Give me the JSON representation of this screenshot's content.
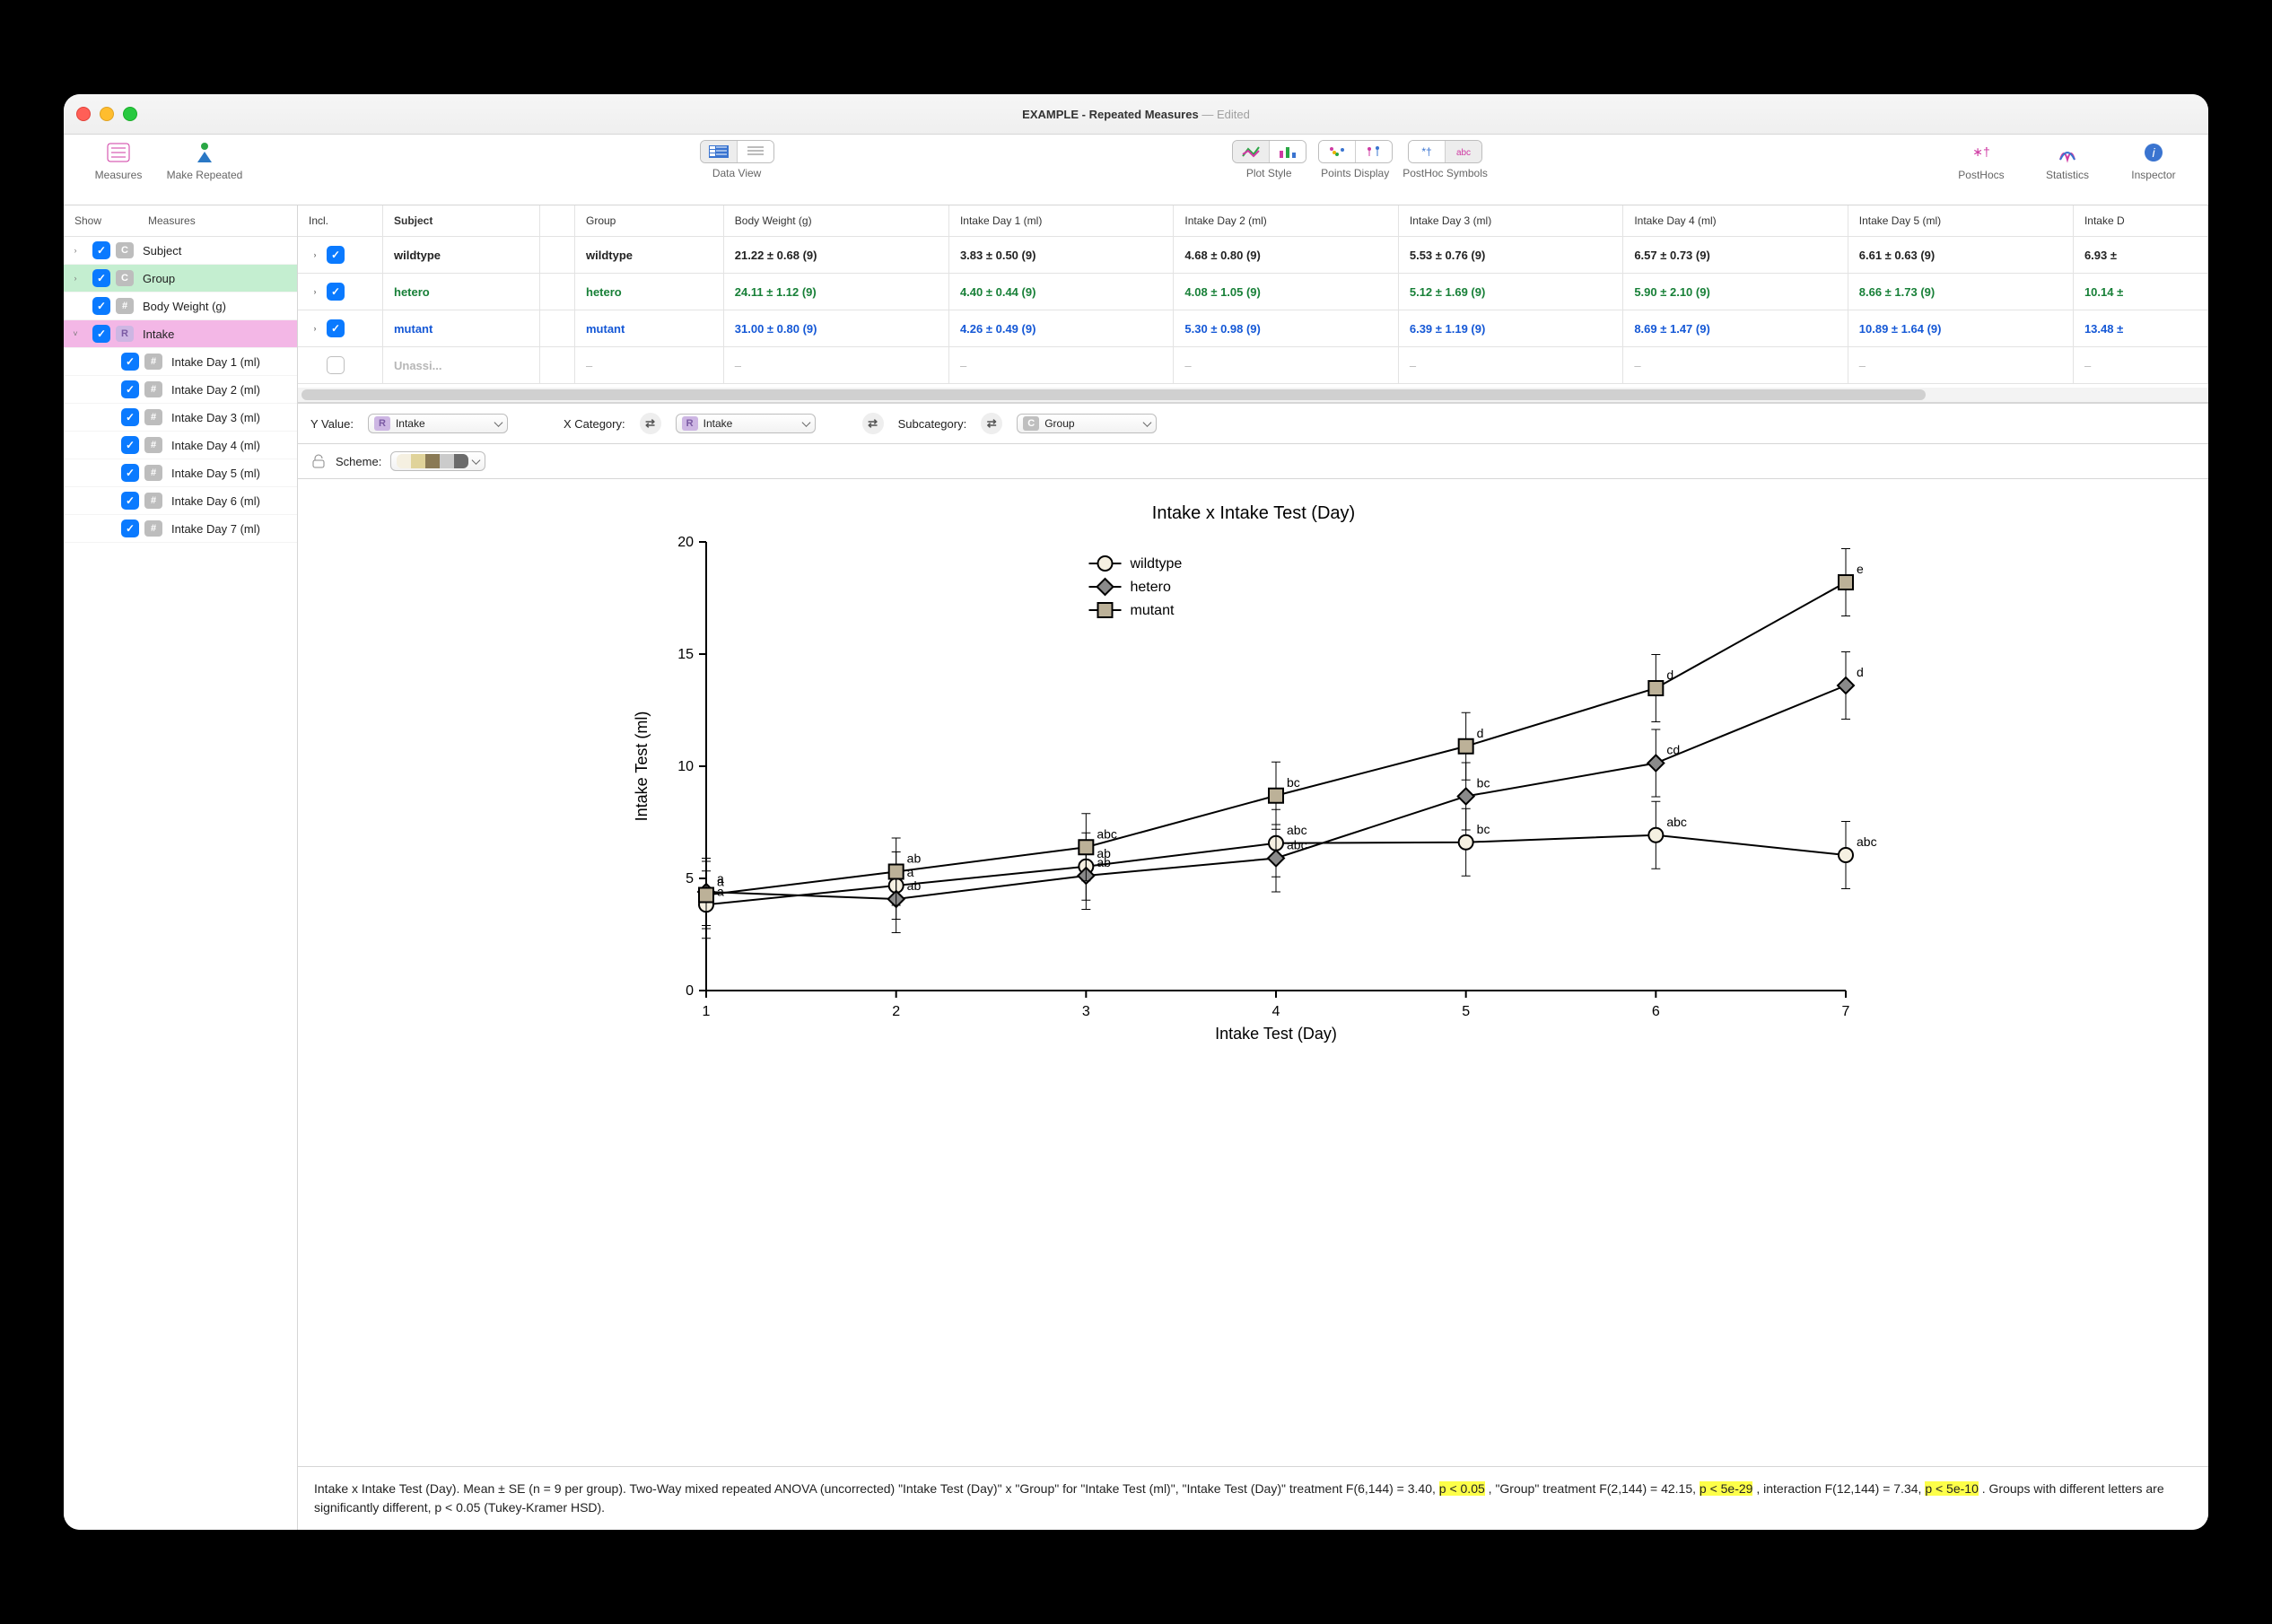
{
  "window_title": "EXAMPLE - Repeated Measures",
  "window_edited": "Edited",
  "toolbar": {
    "measures": "Measures",
    "make_repeated": "Make Repeated",
    "data_view": "Data View",
    "plot_style": "Plot Style",
    "points_display": "Points Display",
    "posthoc_symbols": "PostHoc Symbols",
    "posthocs": "PostHocs",
    "statistics": "Statistics",
    "inspector": "Inspector"
  },
  "sidebar": {
    "show": "Show",
    "measures": "Measures",
    "items": [
      {
        "label": "Subject",
        "icon": "C",
        "expandable": true,
        "checked": true,
        "hl": ""
      },
      {
        "label": "Group",
        "icon": "C",
        "expandable": true,
        "checked": true,
        "hl": "green"
      },
      {
        "label": "Body Weight (g)",
        "icon": "#",
        "expandable": false,
        "checked": true,
        "hl": ""
      },
      {
        "label": "Intake",
        "icon": "R",
        "expandable": true,
        "checked": true,
        "hl": "pink",
        "open": true
      },
      {
        "label": "Intake Day 1 (ml)",
        "icon": "#",
        "child": true,
        "checked": true
      },
      {
        "label": "Intake Day 2 (ml)",
        "icon": "#",
        "child": true,
        "checked": true
      },
      {
        "label": "Intake Day 3 (ml)",
        "icon": "#",
        "child": true,
        "checked": true
      },
      {
        "label": "Intake Day 4 (ml)",
        "icon": "#",
        "child": true,
        "checked": true
      },
      {
        "label": "Intake Day 5 (ml)",
        "icon": "#",
        "child": true,
        "checked": true
      },
      {
        "label": "Intake Day 6 (ml)",
        "icon": "#",
        "child": true,
        "checked": true
      },
      {
        "label": "Intake Day 7 (ml)",
        "icon": "#",
        "child": true,
        "checked": true
      }
    ]
  },
  "table": {
    "headers": [
      "Incl.",
      "Subject",
      "",
      "Group",
      "Body Weight (g)",
      "Intake Day 1 (ml)",
      "Intake Day 2 (ml)",
      "Intake Day 3 (ml)",
      "Intake Day 4 (ml)",
      "Intake Day 5 (ml)",
      "Intake D"
    ],
    "rows": [
      {
        "cls": "wildtype",
        "incl": true,
        "subject": "wildtype",
        "group": "wildtype",
        "cells": [
          "21.22 ± 0.68 (9)",
          "3.83 ± 0.50 (9)",
          "4.68 ± 0.80 (9)",
          "5.53 ± 0.76 (9)",
          "6.57 ± 0.73 (9)",
          "6.61 ± 0.63 (9)",
          "6.93 ±"
        ]
      },
      {
        "cls": "hetero",
        "incl": true,
        "subject": "hetero",
        "group": "hetero",
        "cells": [
          "24.11 ± 1.12 (9)",
          "4.40 ± 0.44 (9)",
          "4.08 ± 1.05 (9)",
          "5.12 ± 1.69 (9)",
          "5.90 ± 2.10 (9)",
          "8.66 ± 1.73 (9)",
          "10.14 ±"
        ]
      },
      {
        "cls": "mutant",
        "incl": true,
        "subject": "mutant",
        "group": "mutant",
        "cells": [
          "31.00 ± 0.80 (9)",
          "4.26 ± 0.49 (9)",
          "5.30 ± 0.98 (9)",
          "6.39 ± 1.19 (9)",
          "8.69 ± 1.47 (9)",
          "10.89 ± 1.64 (9)",
          "13.48 ±"
        ]
      },
      {
        "cls": "unassigned",
        "incl": false,
        "subject": "Unassi...",
        "group": "–",
        "cells": [
          "–",
          "–",
          "–",
          "–",
          "–",
          "–",
          "–"
        ]
      }
    ]
  },
  "controls": {
    "yvalue_label": "Y Value:",
    "yvalue_value": "Intake",
    "xcat_label": "X Category:",
    "xcat_value": "Intake",
    "subcat_label": "Subcategory:",
    "subcat_value": "Group",
    "scheme_label": "Scheme:"
  },
  "chart": {
    "title": "Intake x Intake Test (Day)",
    "ylabel": "Intake Test (ml)",
    "xlabel": "Intake Test (Day)",
    "legend": {
      "wildtype": "wildtype",
      "hetero": "hetero",
      "mutant": "mutant"
    },
    "ticks_y": [
      "0",
      "5",
      "10",
      "15",
      "20"
    ],
    "ticks_x": [
      "1",
      "2",
      "3",
      "4",
      "5",
      "6",
      "7"
    ],
    "annos": {
      "wildtype": [
        "a",
        "a",
        "ab",
        "abc",
        "bc",
        "abc",
        "abc"
      ],
      "hetero": [
        "a",
        "ab",
        "ab",
        "abc",
        "bc",
        "cd",
        "d"
      ],
      "mutant": [
        "a",
        "ab",
        "abc",
        "bc",
        "d",
        "d",
        "e"
      ]
    }
  },
  "chart_data": {
    "type": "line",
    "title": "Intake x Intake Test (Day)",
    "xlabel": "Intake Test (Day)",
    "ylabel": "Intake Test (ml)",
    "x": [
      1,
      2,
      3,
      4,
      5,
      6,
      7
    ],
    "ylim": [
      0,
      20
    ],
    "series": [
      {
        "name": "wildtype",
        "values": [
          3.83,
          4.68,
          5.53,
          6.57,
          6.61,
          6.93,
          6.04
        ]
      },
      {
        "name": "hetero",
        "values": [
          4.4,
          4.08,
          5.12,
          5.9,
          8.66,
          10.14,
          13.6
        ]
      },
      {
        "name": "mutant",
        "values": [
          4.26,
          5.3,
          6.39,
          8.69,
          10.89,
          13.48,
          18.2
        ]
      }
    ],
    "legend_position": "top-center"
  },
  "stats": {
    "pre1": "Intake x Intake Test (Day).  Mean ± SE (n = 9 per group). Two-Way mixed repeated ANOVA (uncorrected) \"Intake Test (Day)\" x \"Group\" for \"Intake Test (ml)\", \"Intake Test (Day)\" treatment F(6,144) = 3.40, ",
    "p1": "p < 0.05",
    "mid1": " , \"Group\" treatment F(2,144) = 42.15, ",
    "p2": "p < 5e-29",
    "mid2": " , interaction F(12,144) = 7.34, ",
    "p3": "p < 5e-10",
    "post": " . Groups with different letters are significantly different, p < 0.05 (Tukey-Kramer HSD)."
  },
  "colors": {
    "accent": "#0a7aff",
    "green": "#188038",
    "link": "#1558d6",
    "scheme": [
      "#f5f0e1",
      "#e0d39a",
      "#8a7a55",
      "#cbcbcb",
      "#6b6b6b"
    ]
  }
}
